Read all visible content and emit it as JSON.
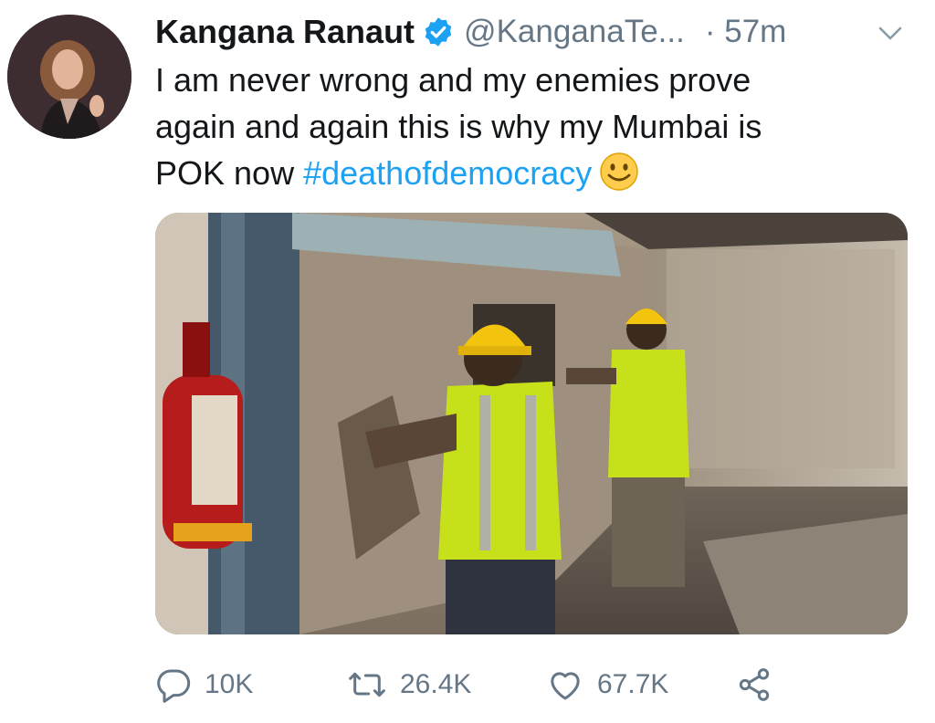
{
  "tweet": {
    "author_name": "Kangana Ranaut",
    "handle": "@KanganaTe...",
    "time": "· 57m",
    "text_lines": [
      "I am never wrong and my enemies prove",
      "again and again this is why my Mumbai is"
    ],
    "text_last_prefix": "POK now ",
    "hashtag": "#deathofdemocracy",
    "verified_icon": "verified-badge-icon",
    "emoji": "slightly-smiling-face"
  },
  "media": {
    "description_icon": "photo"
  },
  "actions": {
    "reply_count": "10K",
    "retweet_count": "26.4K",
    "like_count": "67.7K"
  },
  "colors": {
    "accent": "#1da1f2",
    "secondary_text": "#657786",
    "primary_text": "#14171a"
  }
}
